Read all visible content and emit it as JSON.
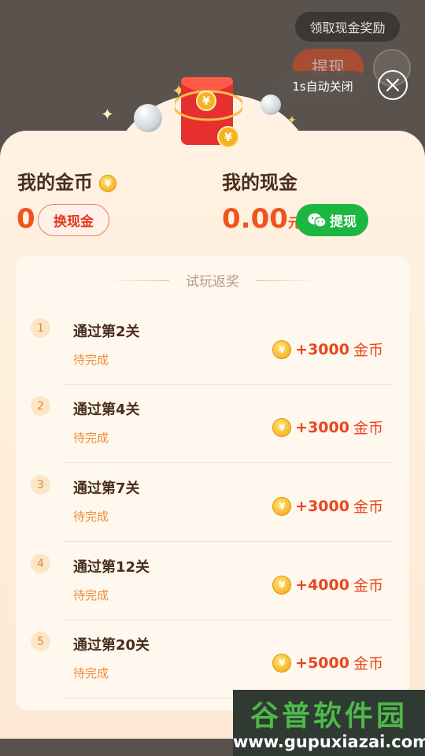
{
  "background": {
    "withdraw_label": "提现",
    "tooltip": "领取现金奖励"
  },
  "auto_close": "1s自动关闭",
  "coins": {
    "label": "我的金币",
    "value": "0",
    "exchange_label": "换现金",
    "coin_symbol": "¥"
  },
  "cash": {
    "label": "我的现金",
    "value": "0.00",
    "unit": "元",
    "withdraw_label": "提现"
  },
  "tasks": {
    "title": "试玩返奖",
    "items": [
      {
        "index": "1",
        "title": "通过第2关",
        "status": "待完成",
        "amount": "+3000",
        "unit": "金币"
      },
      {
        "index": "2",
        "title": "通过第4关",
        "status": "待完成",
        "amount": "+3000",
        "unit": "金币"
      },
      {
        "index": "3",
        "title": "通过第7关",
        "status": "待完成",
        "amount": "+3000",
        "unit": "金币"
      },
      {
        "index": "4",
        "title": "通过第12关",
        "status": "待完成",
        "amount": "+4000",
        "unit": "金币"
      },
      {
        "index": "5",
        "title": "通过第20关",
        "status": "待完成",
        "amount": "+5000",
        "unit": "金币"
      }
    ]
  },
  "watermark": {
    "cn": "谷普软件园",
    "url": "www.gupuxiazai.com"
  },
  "colors": {
    "accent": "#e8471e",
    "wechat": "#1cb741",
    "panel": "#fff2e2"
  }
}
